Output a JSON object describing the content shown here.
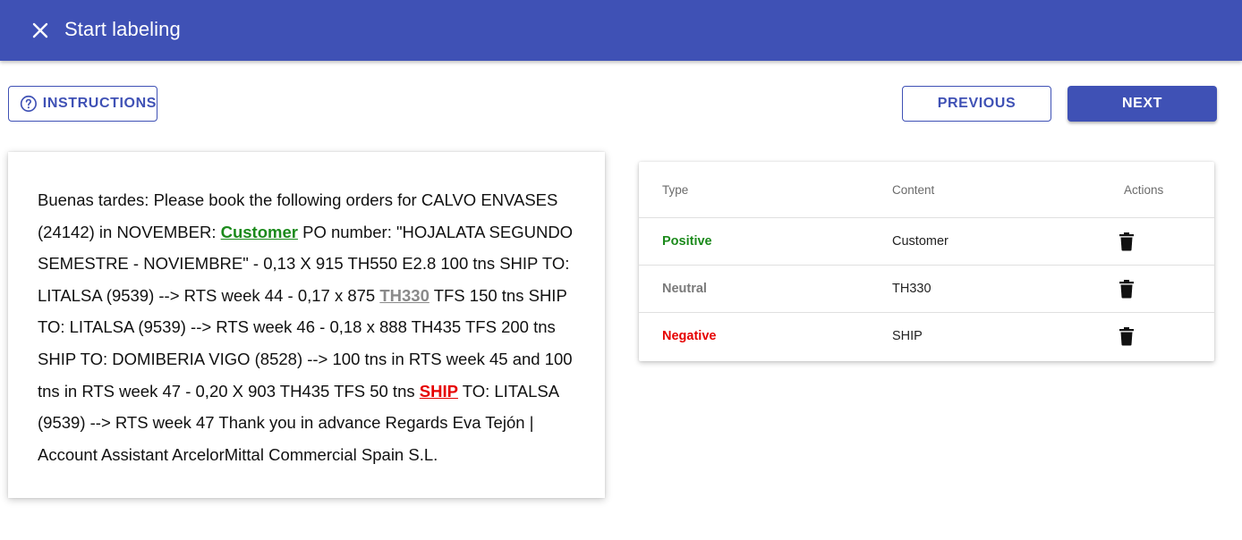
{
  "header": {
    "title": "Start labeling",
    "close_icon": "close-icon",
    "background_color": "#3f51b5"
  },
  "toolbar": {
    "instructions_label": "INSTRUCTIONS",
    "instructions_icon": "help-circle-icon",
    "previous_label": "PREVIOUS",
    "next_label": "NEXT"
  },
  "document": {
    "segments": [
      {
        "text": "Buenas tardes: Please book the following orders for CALVO ENVASES (24142) in NOVEMBER: "
      },
      {
        "text": "Customer",
        "label": "Positive"
      },
      {
        "text": " PO number: \"HOJALATA SEGUNDO SEMESTRE - NOVIEMBRE\" - 0,13 X 915 TH550 E2.8 100 tns SHIP TO: LITALSA (9539) --> RTS week 44 - 0,17 x 875 "
      },
      {
        "text": "TH330",
        "label": "Neutral"
      },
      {
        "text": " TFS 150 tns SHIP TO: LITALSA (9539) --> RTS week 46 - 0,18 x 888 TH435 TFS 200 tns SHIP TO: DOMIBERIA VIGO (8528) --> 100 tns in RTS week 45 and 100 tns in RTS week 47 - 0,20 X 903 TH435 TFS 50 tns "
      },
      {
        "text": "SHIP",
        "label": "Negative"
      },
      {
        "text": " TO: LITALSA (9539) --> RTS week 47 Thank you in advance Regards Eva Tejón | Account Assistant ArcelorMittal Commercial Spain S.L."
      }
    ]
  },
  "labels_table": {
    "headers": {
      "type": "Type",
      "content": "Content",
      "actions": "Actions"
    },
    "rows": [
      {
        "type": "Positive",
        "content": "Customer",
        "action_icon": "delete-icon"
      },
      {
        "type": "Neutral",
        "content": "TH330",
        "action_icon": "delete-icon"
      },
      {
        "type": "Negative",
        "content": "SHIP",
        "action_icon": "delete-icon"
      }
    ]
  },
  "colors": {
    "primary": "#3f51b5",
    "positive": "#1b8a1b",
    "neutral": "#8a8a8a",
    "negative": "#e60000"
  }
}
